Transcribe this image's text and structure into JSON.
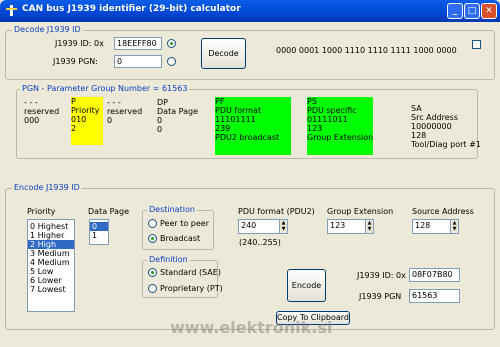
{
  "window": {
    "title": "CAN bus J1939 identifier (29-bit) calculator",
    "minimize": "_",
    "maximize": "□",
    "close": "✕"
  },
  "decode": {
    "legend": "Decode J1939 ID",
    "id_label": "J1939 ID: 0x",
    "id_value": "18EEFF80",
    "pgn_label": "J1939 PGN:",
    "pgn_value": "0",
    "button": "Decode",
    "binary": "0000 0001 1000 1110 1110 1111 1000 0000"
  },
  "pgn_section": {
    "legend": "PGN - Parameter Group Number = 61563",
    "cols": [
      {
        "head": "- - -",
        "l2": "reserved",
        "l3": "000",
        "l4": ""
      },
      {
        "head": "P",
        "l2": "Priority",
        "l3": "010",
        "l4": "2"
      },
      {
        "head": "- - -",
        "l2": "reserved",
        "l3": "0",
        "l4": ""
      },
      {
        "head": "DP",
        "l2": "Data Page",
        "l3": "0",
        "l4": "0"
      },
      {
        "head": "PF",
        "l2": "PDU format",
        "l3": "11101111",
        "l4": "239",
        "l5": "PDU2 broadcast"
      },
      {
        "head": "PS",
        "l2": "PDU specific",
        "l3": "01111011",
        "l4": "123",
        "l5": "Group Extension"
      }
    ],
    "sa": {
      "l1": "SA",
      "l2": "Src Address",
      "l3": "10000000",
      "l4": "128",
      "l5": "Tool/Diag port #1"
    }
  },
  "encode": {
    "legend": "Encode J1939 ID",
    "priority_label": "Priority",
    "priorities": [
      "0 Highest",
      "1 Higher",
      "2 High",
      "3 Medium",
      "4 Medium",
      "5 Low",
      "6 Lower",
      "7 Lowest"
    ],
    "datapage_label": "Data Page",
    "datapages": [
      "0",
      "1"
    ],
    "destination_legend": "Destination",
    "dest_peer": "Peer to peer",
    "dest_broadcast": "Broadcast",
    "definition_legend": "Definition",
    "def_standard": "Standard (SAE)",
    "def_proprietary": "Proprietary (PT)",
    "pdu_format_label": "PDU format (PDU2)",
    "pdu_format_value": "240",
    "pdu_range": "(240..255)",
    "group_ext_label": "Group Extension",
    "group_ext_value": "123",
    "src_addr_label": "Source Address",
    "src_addr_value": "128",
    "button": "Encode",
    "id_label": "J1939 ID: 0x",
    "id_value": "08F07B80",
    "pgn_label": "J1939 PGN",
    "pgn_value": "61563",
    "copy_button": "Copy To Clipboard"
  },
  "watermark": "www.elektronik.si"
}
